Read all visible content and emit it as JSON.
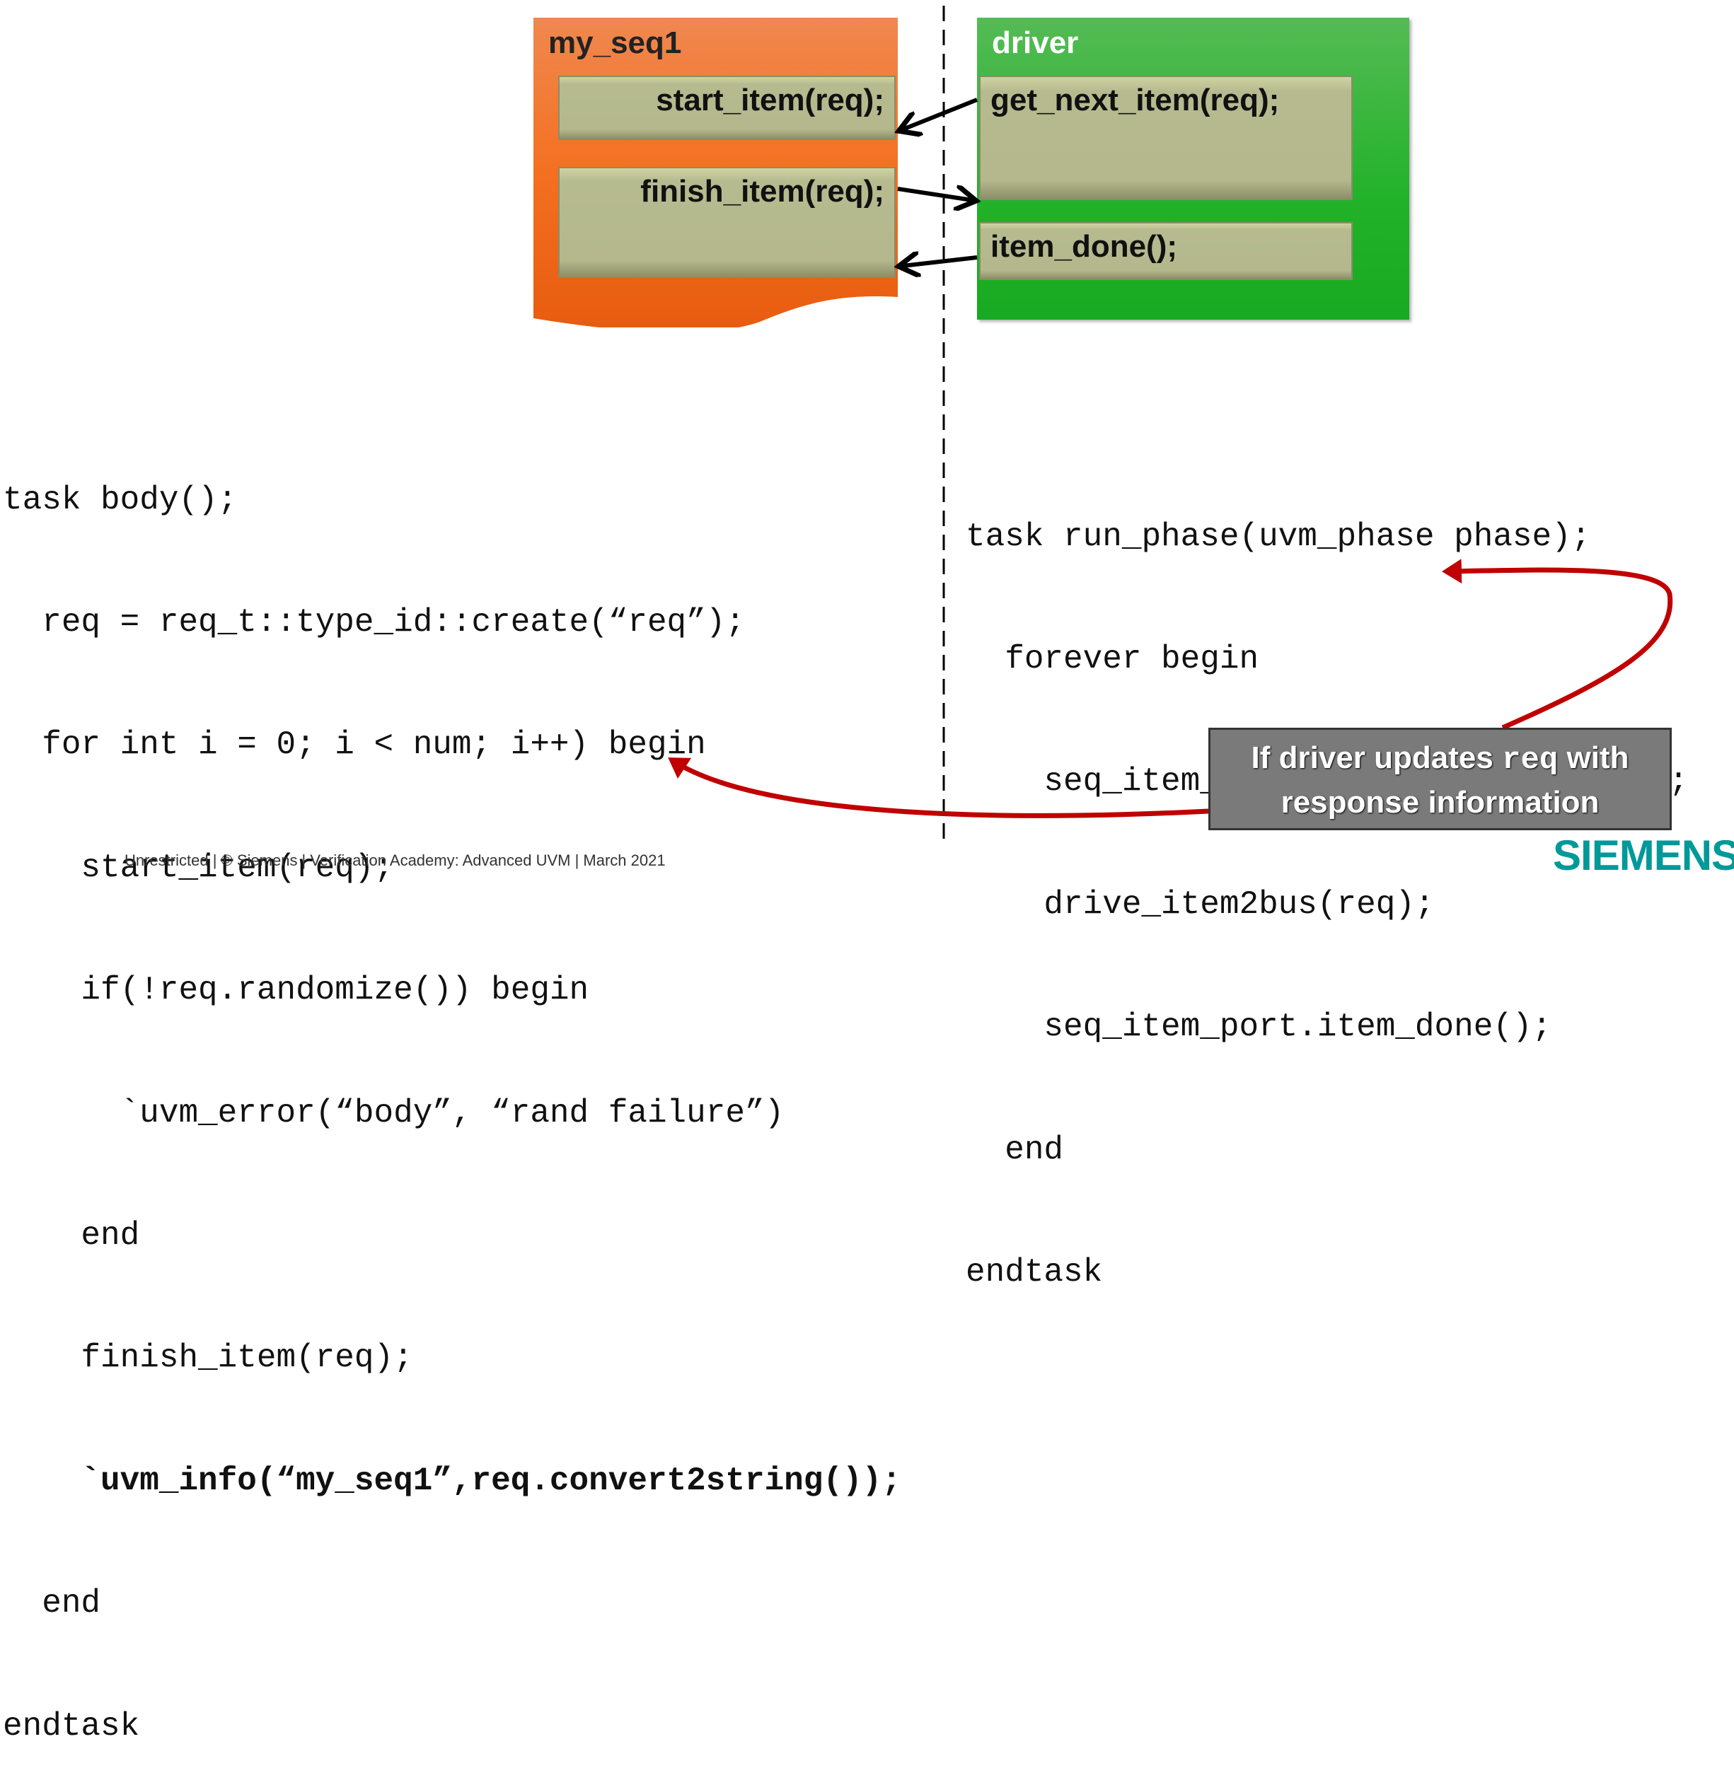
{
  "diagram": {
    "sequence": {
      "title": "my_seq1",
      "start_item": "start_item(req);",
      "finish_item": "finish_item(req);"
    },
    "driver": {
      "title": "driver",
      "get_next_item": "get_next_item(req);",
      "item_done": "item_done();"
    }
  },
  "code_left": [
    "task body();",
    "  req = req_t::type_id::create(“req”);",
    "  for int i = 0; i < num; i++) begin",
    "    start_item(req);",
    "    if(!req.randomize()) begin",
    "      `uvm_error(“body”, “rand failure”)",
    "    end",
    "    finish_item(req);",
    "    `uvm_info(“my_seq1”,req.convert2string());",
    "  end",
    "endtask"
  ],
  "code_right": [
    "task run_phase(uvm_phase phase);",
    "  forever begin",
    "    seq_item_port.get_next_item(req);",
    "    drive_item2bus(req);",
    "    seq_item_port.item_done();",
    "  end",
    "endtask"
  ],
  "note": {
    "line1_pre": "If driver updates ",
    "line1_code": "req",
    "line1_post": " with",
    "line2": "response information"
  },
  "footer": "Unrestricted | © Siemens | Verification Academy: Advanced UVM | March 2021",
  "logo": "SIEMENS",
  "colors": {
    "sequence": "#f47020",
    "driver": "#22b22a",
    "inner_box": "#b4b88c",
    "arrow_red": "#c00000",
    "logo": "#009999",
    "note_bg": "#7a7a7a"
  }
}
